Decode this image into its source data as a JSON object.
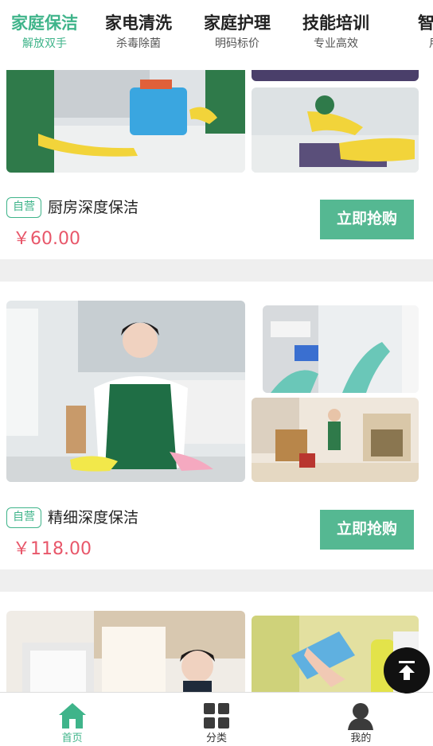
{
  "top_tabs": [
    {
      "title": "家庭保洁",
      "sub": "解放双手",
      "active": true
    },
    {
      "title": "家电清洗",
      "sub": "杀毒除菌"
    },
    {
      "title": "家庭护理",
      "sub": "明码标价"
    },
    {
      "title": "技能培训",
      "sub": "专业高效"
    },
    {
      "title": "智能",
      "sub": "用"
    }
  ],
  "products": [
    {
      "badge": "自营",
      "name": "厨房深度保洁",
      "price": "￥60.00",
      "buy_label": "立即抢购"
    },
    {
      "badge": "自营",
      "name": "精细深度保洁",
      "price": "￥118.00",
      "buy_label": "立即抢购"
    }
  ],
  "bottom_tabs": [
    {
      "label": "首页",
      "icon": "home-icon",
      "active": true
    },
    {
      "label": "分类",
      "icon": "grid-icon"
    },
    {
      "label": "我的",
      "icon": "user-icon"
    }
  ],
  "colors": {
    "accent": "#3fb48a",
    "button": "#55b892",
    "price": "#e8576a"
  }
}
